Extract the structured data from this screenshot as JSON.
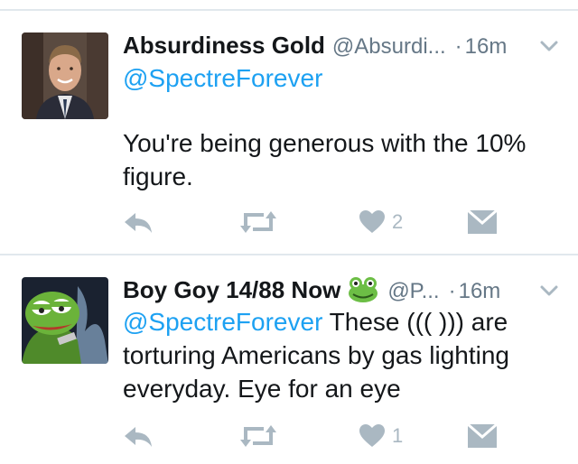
{
  "tweets": [
    {
      "display_name": "Absurdiness Gold",
      "handle": "@Absurdi...",
      "separator": "·",
      "timestamp": "16m",
      "reply_to": "@SpectreForever",
      "text": "You're being generous with the 10% figure.",
      "like_count": "2",
      "avatar": "person-photo"
    },
    {
      "display_name": "Boy Goy 14/88 Now",
      "name_emoji": "frog-icon",
      "handle": "@P...",
      "separator": "·",
      "timestamp": "16m",
      "mention": "@SpectreForever",
      "text": "These ((( ))) are torturing Americans by gas lighting everyday. Eye for an eye",
      "like_count": "1",
      "avatar": "pepe-frog-cartoon"
    }
  ],
  "colors": {
    "link": "#1da1f2",
    "text": "#14171a",
    "muted": "#657786",
    "icon": "#aab8c2",
    "divider": "#e1e8ed"
  }
}
